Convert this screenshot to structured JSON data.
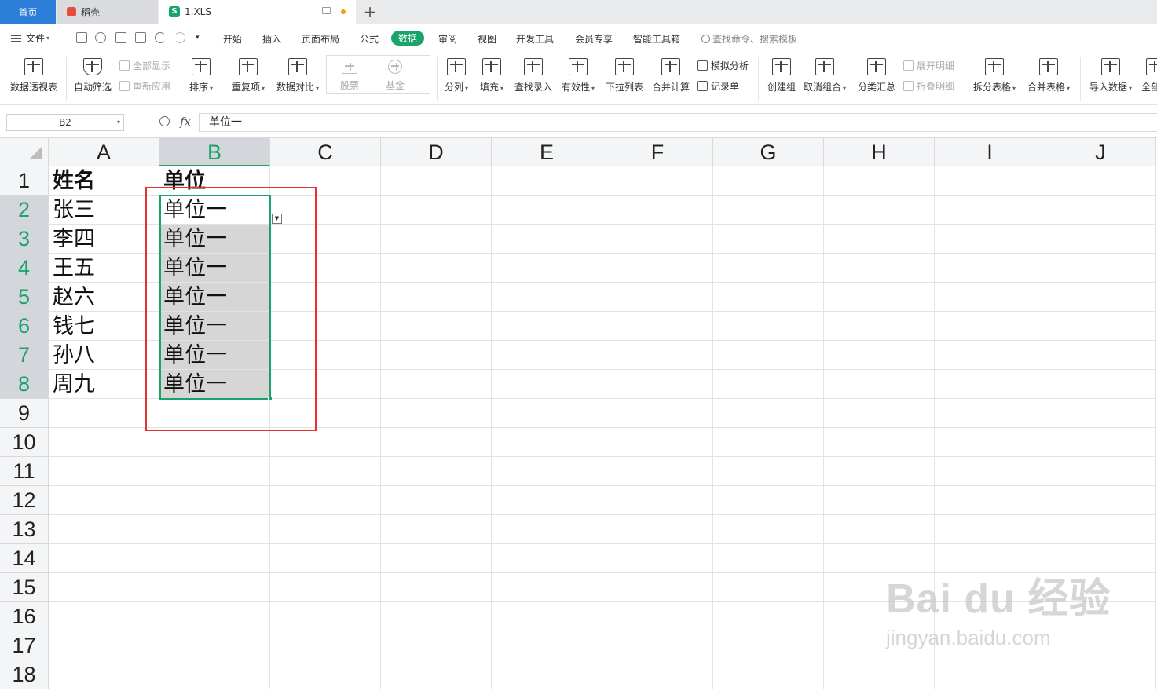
{
  "tabs": {
    "home": "首页",
    "docer": "稻壳",
    "file": "1.XLS",
    "file_icon": "S"
  },
  "menu": {
    "file": "文件",
    "items": [
      "开始",
      "插入",
      "页面布局",
      "公式",
      "数据",
      "审阅",
      "视图",
      "开发工具",
      "会员专享",
      "智能工具箱"
    ],
    "active": "数据",
    "search": "查找命令、搜索模板"
  },
  "ribbon": {
    "pivot": "数据透视表",
    "autofilter": "自动筛选",
    "show_all": "全部显示",
    "reapply": "重新应用",
    "sort": "排序",
    "duplicates": "重复项",
    "compare": "数据对比",
    "stock": "股票",
    "fund": "基金",
    "split_col": "分列",
    "fill": "填充",
    "lookup": "查找录入",
    "validity": "有效性",
    "dropdown": "下拉列表",
    "consolidate": "合并计算",
    "simulate": "模拟分析",
    "record": "记录单",
    "create_group": "创建组",
    "ungroup": "取消组合",
    "subtotal": "分类汇总",
    "expand_detail": "展开明细",
    "collapse_detail": "折叠明细",
    "split_table": "拆分表格",
    "merge_table": "合并表格",
    "import": "导入数据",
    "all": "全部"
  },
  "formula_bar": {
    "cell_ref": "B2",
    "fx": "fx",
    "content": "单位一"
  },
  "columns": [
    "A",
    "B",
    "C",
    "D",
    "E",
    "F",
    "G",
    "H",
    "I",
    "J"
  ],
  "rows": [
    "1",
    "2",
    "3",
    "4",
    "5",
    "6",
    "7",
    "8",
    "9",
    "10",
    "11",
    "12",
    "13",
    "14",
    "15",
    "16",
    "17",
    "18"
  ],
  "selected_column": "B",
  "selected_rows": [
    "2",
    "3",
    "4",
    "5",
    "6",
    "7",
    "8"
  ],
  "cells": {
    "A1": "姓名",
    "B1": "单位",
    "A2": "张三",
    "B2": "单位一",
    "A3": "李四",
    "B3": "单位一",
    "A4": "王五",
    "B4": "单位一",
    "A5": "赵六",
    "B5": "单位一",
    "A6": "钱七",
    "B6": "单位一",
    "A7": "孙八",
    "B7": "单位一",
    "A8": "周九",
    "B8": "单位一"
  },
  "watermark": {
    "line1": "Bai du 经验",
    "line2": "jingyan.baidu.com"
  },
  "colors": {
    "accent": "#1aa36b",
    "home_tab": "#2d7ed8",
    "annotation": "#e8302f",
    "selection_fill": "#d6d6d6"
  }
}
